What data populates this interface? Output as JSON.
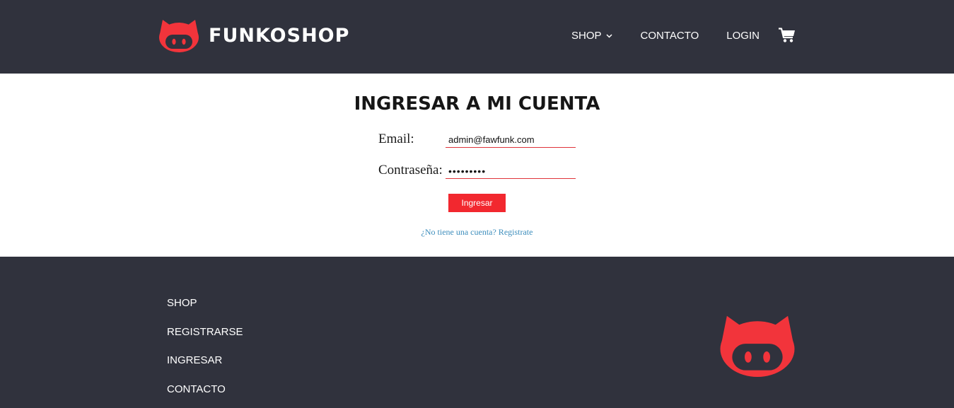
{
  "header": {
    "brand": "FUNKOSHOP",
    "logo_icon": "funko-cat-logo",
    "nav": [
      {
        "label": "SHOP",
        "icon": "chevron-down-icon"
      },
      {
        "label": "CONTACTO"
      },
      {
        "label": "LOGIN"
      }
    ],
    "cart_icon": "shopping-cart-icon"
  },
  "login": {
    "title": "INGRESAR A MI CUENTA",
    "email_label": "Email:",
    "email_value": "admin@fawfunk.com",
    "password_label": "Contraseña:",
    "password_value": "•••••••••",
    "submit_label": "Ingresar",
    "register_link": "¿No tiene una cuenta? Registrate"
  },
  "footer": {
    "links": [
      "SHOP",
      "REGISTRARSE",
      "INGRESAR",
      "CONTACTO"
    ],
    "logo_icon": "funko-cat-logo"
  },
  "colors": {
    "header_bg": "#30323d",
    "accent": "#f2282f",
    "input_underline": "#e0343b",
    "link": "#3c8dbc"
  }
}
